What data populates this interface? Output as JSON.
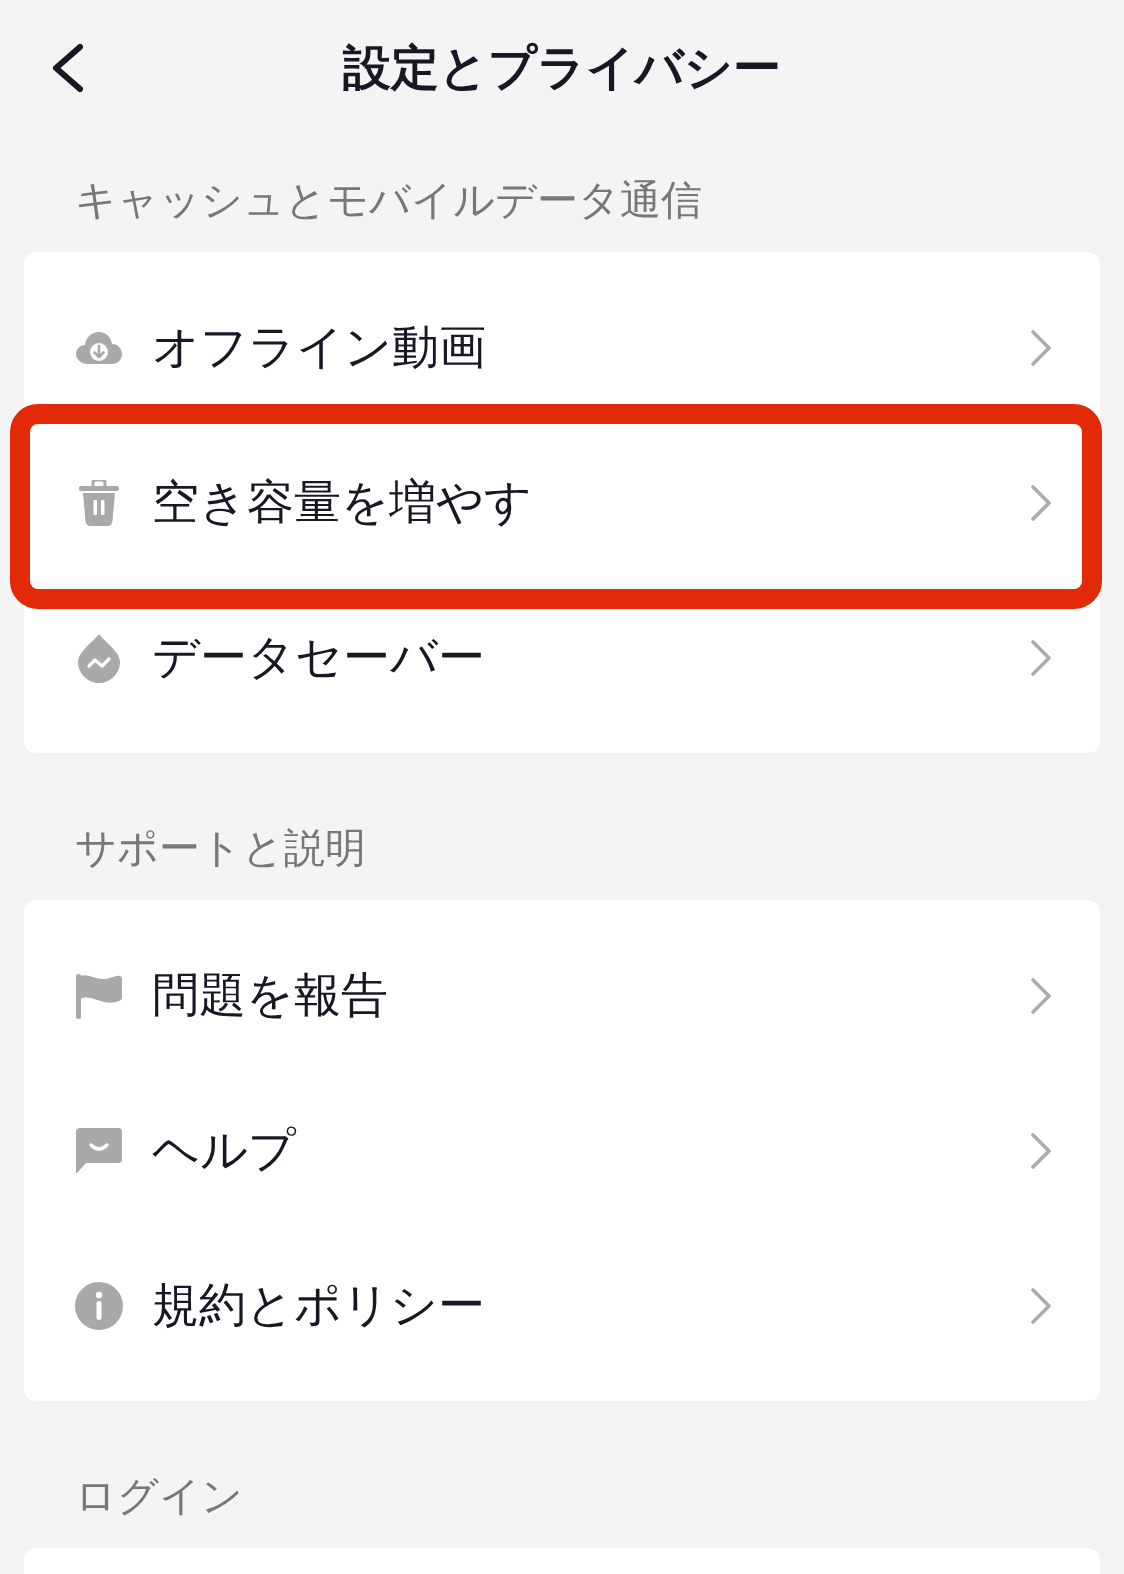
{
  "header": {
    "title": "設定とプライバシー"
  },
  "sections": [
    {
      "title": "キャッシュとモバイルデータ通信",
      "items": [
        {
          "kind": "cloud",
          "label": "オフライン動画",
          "highlighted": false
        },
        {
          "kind": "trash",
          "label": "空き容量を増やす",
          "highlighted": true
        },
        {
          "kind": "drop",
          "label": "データセーバー",
          "highlighted": false
        }
      ]
    },
    {
      "title": "サポートと説明",
      "items": [
        {
          "kind": "flag",
          "label": "問題を報告",
          "highlighted": false
        },
        {
          "kind": "chat",
          "label": "ヘルプ",
          "highlighted": false
        },
        {
          "kind": "info",
          "label": "規約とポリシー",
          "highlighted": false
        }
      ]
    },
    {
      "title": "ログイン"
    }
  ]
}
